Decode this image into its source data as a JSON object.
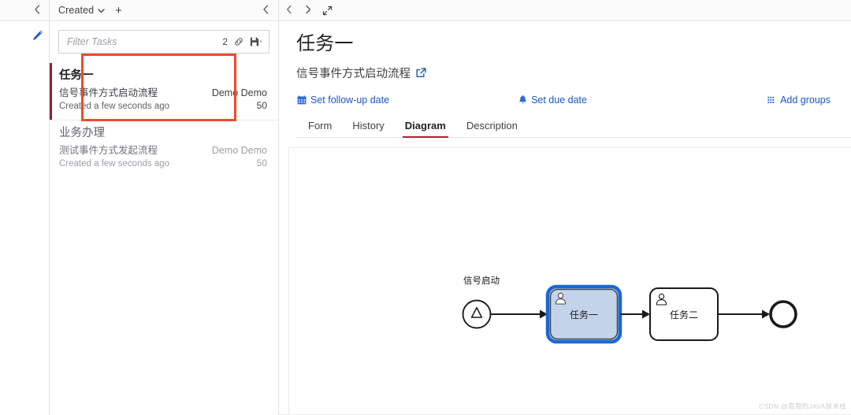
{
  "rail": {
    "collapse_icon": "chevron-left-icon",
    "edit_icon": "pencil-icon"
  },
  "task_list": {
    "sort_label": "Created",
    "sort_caret": "chevron-down-icon",
    "add_label": "+",
    "collapse_icon": "chevron-left-icon",
    "filter": {
      "placeholder": "Filter Tasks",
      "value": "",
      "count": "2",
      "link_icon": "link-icon",
      "save_icon": "save-icon",
      "save_caret": "chevron-down-icon"
    },
    "items": [
      {
        "title": "任务一",
        "subtitle": "信号事件方式启动流程",
        "meta": "Created a few seconds ago",
        "assignee": "Demo Demo",
        "priority": "50",
        "selected": true
      },
      {
        "title": "业务办理",
        "subtitle": "测试事件方式发起流程",
        "meta": "Created a few seconds ago",
        "assignee": "Demo Demo",
        "priority": "50",
        "selected": false
      }
    ]
  },
  "detail": {
    "topbar": {
      "prev_icon": "chevron-left-icon",
      "next_icon": "chevron-right-icon",
      "expand_icon": "expand-diagonal-icon"
    },
    "title": "任务一",
    "process_name": "信号事件方式启动流程",
    "process_link_icon": "external-link-icon",
    "actions": [
      {
        "label": "Set follow-up date",
        "icon": "calendar-icon"
      },
      {
        "label": "Set due date",
        "icon": "bell-icon"
      },
      {
        "label": "Add groups",
        "icon": "grid-dots-icon"
      }
    ],
    "tabs": [
      {
        "label": "Form",
        "active": false
      },
      {
        "label": "History",
        "active": false
      },
      {
        "label": "Diagram",
        "active": true
      },
      {
        "label": "Description",
        "active": false
      }
    ]
  },
  "diagram": {
    "start_event": {
      "label": "信号启动",
      "type": "signal-start-event"
    },
    "tasks": [
      {
        "label": "任务一",
        "type": "user-task",
        "highlighted": true
      },
      {
        "label": "任务二",
        "type": "user-task",
        "highlighted": false
      }
    ],
    "end_event": {
      "type": "end-event"
    },
    "colors": {
      "highlight_fill": "#c3d4ea",
      "highlight_stroke": "#1a69d4",
      "shape_stroke": "#1a1a1a"
    }
  },
  "watermark": "CSDN @周周的JAVA技术栈"
}
